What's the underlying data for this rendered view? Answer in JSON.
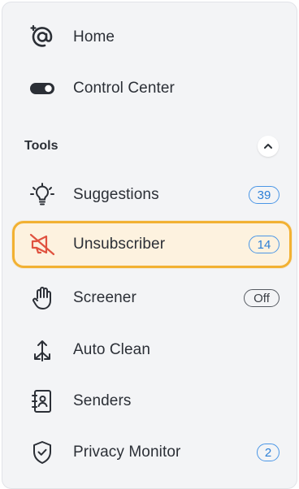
{
  "nav": {
    "home": {
      "label": "Home",
      "icon": "at-sign-sparkle-icon"
    },
    "control_center": {
      "label": "Control Center",
      "icon": "toggle-icon"
    }
  },
  "tools": {
    "title": "Tools",
    "collapse_icon": "chevron-up-icon",
    "items": [
      {
        "label": "Suggestions",
        "badge": "39",
        "icon": "lightbulb-icon"
      },
      {
        "label": "Unsubscriber",
        "badge": "14",
        "icon": "muted-megaphone-icon",
        "active": true
      },
      {
        "label": "Screener",
        "badge": "Off",
        "icon": "hand-icon"
      },
      {
        "label": "Auto Clean",
        "badge": "",
        "icon": "arrows-split-icon"
      },
      {
        "label": "Senders",
        "badge": "",
        "icon": "contact-book-icon"
      },
      {
        "label": "Privacy Monitor",
        "badge": "2",
        "icon": "shield-check-icon"
      }
    ]
  },
  "colors": {
    "accent_blue": "#2c7fd6",
    "active_border": "#f2b132",
    "active_bg": "#fdf2df",
    "active_icon": "#e0523f"
  }
}
